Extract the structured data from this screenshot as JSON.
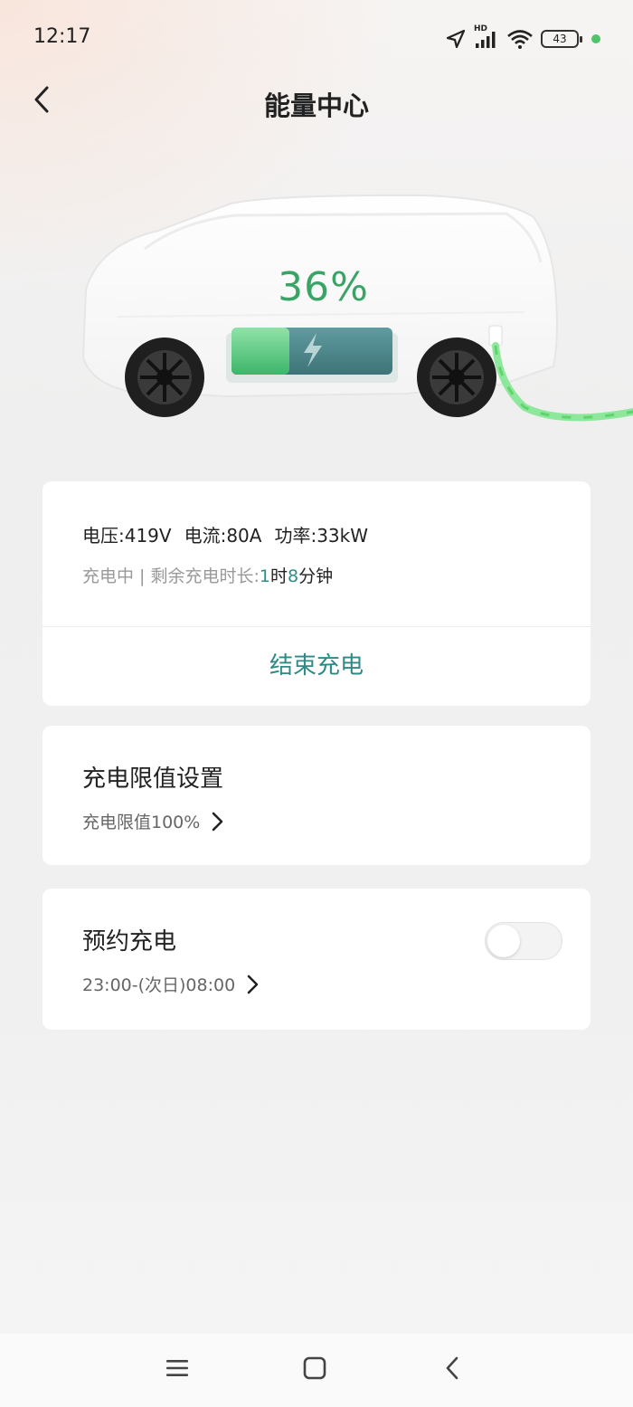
{
  "status_bar": {
    "time": "12:17",
    "network_label": "HD",
    "battery_level": "43",
    "icons": [
      "location-arrow-icon",
      "signal-bars-icon",
      "wifi-icon",
      "battery-icon",
      "green-dot-indicator"
    ]
  },
  "header": {
    "title": "能量中心",
    "back_icon": "chevron-left-icon"
  },
  "vehicle": {
    "battery_percent_label": "36%",
    "battery_fill_fraction": 0.36,
    "charging_icon": "lightning-bolt-icon",
    "plugged_in": true
  },
  "charging_card": {
    "voltage": "电压:419V",
    "current": "电流:80A",
    "power": "功率:33kW",
    "status_prefix": "充电中 | 剩余充电时长:",
    "hours_value": "1",
    "hours_unit": "时",
    "minutes_value": "8",
    "minutes_unit": "分钟",
    "stop_button_label": "结束充电"
  },
  "limit_card": {
    "title": "充电限值设置",
    "subtitle": "充电限值100%"
  },
  "schedule_card": {
    "title": "预约充电",
    "subtitle": "23:00-(次日)08:00",
    "toggle_on": false
  },
  "nav_bar": {
    "icons": [
      "menu-icon",
      "home-square-icon",
      "back-triangle-icon"
    ]
  },
  "colors": {
    "accent_teal": "#2d8a86",
    "battery_green": "#3aa466",
    "status_dot": "#4fc46a"
  }
}
